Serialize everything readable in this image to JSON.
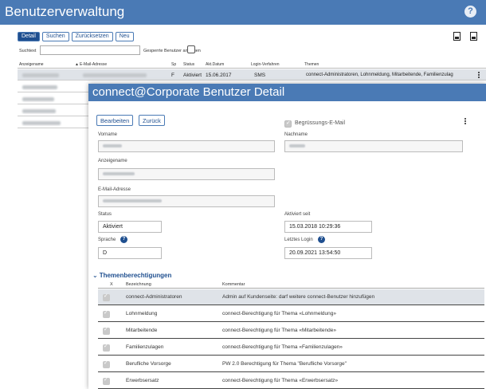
{
  "app": {
    "title": "Benutzerverwaltung"
  },
  "toolbar": {
    "detail": "Detail",
    "suchen": "Suchen",
    "zuruecksetzen": "Zurücksetzen",
    "neu": "Neu"
  },
  "search": {
    "label": "Suchtext",
    "blocked_label": "Gesperrte Benutzer anzeigen"
  },
  "table": {
    "headers": {
      "anzeigename": "Anzeigename",
      "email": "E-Mail-Adresse",
      "sp": "Sp",
      "status": "Status",
      "akt_datum": "Akt.Datum",
      "login": "Login-Verfahren",
      "themen": "Themen"
    },
    "selected_row": {
      "sp": "F",
      "status": "Aktiviert",
      "date": "15.06.2017",
      "login": "SMS",
      "themen": "connect-Administratoren, Lohnmeldung, Mitarbeitende, Familienzulag"
    }
  },
  "dialog": {
    "title": "connect@Corporate Benutzer Detail",
    "bearbeiten": "Bearbeiten",
    "zurueck": "Zurück",
    "vorname_label": "Vorname",
    "nachname_label": "Nachname",
    "anzeigename_label": "Anzeigename",
    "email_label": "E-Mail-Adresse",
    "greeting_label": "Begrüssungs-E-Mail",
    "status_label": "Status",
    "status_value": "Aktiviert",
    "aktiviert_seit_label": "Aktiviert seit",
    "aktiviert_seit_value": "15.03.2018 10:29:36",
    "sprache_label": "Sprache",
    "sprache_value": "D",
    "letztes_login_label": "Letztes Login",
    "letztes_login_value": "20.09.2021 13:54:50",
    "section_title": "Themenberechtigungen",
    "perm_headers": {
      "x": "X",
      "bezeichnung": "Bezeichnung",
      "kommentar": "Kommentar"
    },
    "permissions": [
      {
        "name": "connect-Administratoren",
        "comment": "Admin auf Kundenseite: darf weitere connect-Benutzer hinzufügen"
      },
      {
        "name": "Lohnmeldung",
        "comment": "connect-Berechtigung für Thema «Lohnmeldung»"
      },
      {
        "name": "Mitarbeitende",
        "comment": "connect-Berechtigung für Thema «Mitarbeitende»"
      },
      {
        "name": "Familienzulagen",
        "comment": "connect-Berechtigung für Thema «Familienzulagen»"
      },
      {
        "name": "Berufliche Vorsorge",
        "comment": "PW 2.0 Berechtigung für Thema \"Berufliche Vorsorge\""
      },
      {
        "name": "Erwerbsersatz",
        "comment": "connect-Berechtigung für Thema «Erwerbsersatz»"
      }
    ]
  },
  "colors": {
    "header_blue": "#4a7ab5",
    "accent_dark": "#1f4f8f",
    "row_highlight": "#dfe3e8"
  },
  "icons": [
    "help-icon",
    "pdf-icon",
    "xls-icon",
    "kebab-menu-icon",
    "chevron-down-icon",
    "checkbox-checked-icon",
    "info-icon"
  ]
}
